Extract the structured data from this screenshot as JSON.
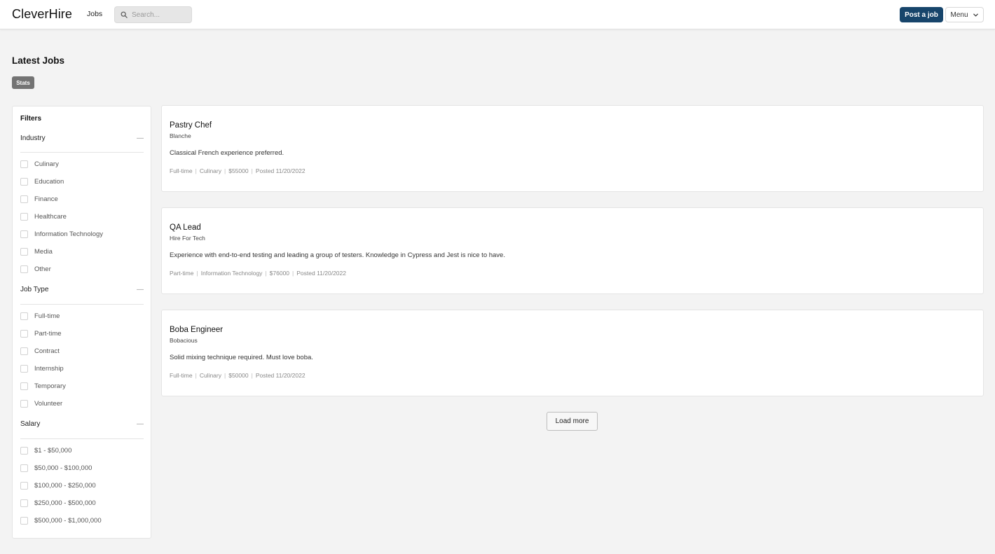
{
  "header": {
    "brand": "CleverHire",
    "nav_jobs": "Jobs",
    "search_placeholder": "Search...",
    "post_job_label": "Post a job",
    "menu_label": "Menu",
    "accent_color": "#17456b"
  },
  "page": {
    "title": "Latest Jobs",
    "stats_label": "Stats"
  },
  "filters": {
    "title": "Filters",
    "sections": [
      {
        "label": "Industry",
        "collapse_symbol": "—",
        "options": [
          "Culinary",
          "Education",
          "Finance",
          "Healthcare",
          "Information Technology",
          "Media",
          "Other"
        ]
      },
      {
        "label": "Job Type",
        "collapse_symbol": "—",
        "options": [
          "Full-time",
          "Part-time",
          "Contract",
          "Internship",
          "Temporary",
          "Volunteer"
        ]
      },
      {
        "label": "Salary",
        "collapse_symbol": "—",
        "options": [
          "$1 - $50,000",
          "$50,000 - $100,000",
          "$100,000 - $250,000",
          "$250,000 - $500,000",
          "$500,000 - $1,000,000"
        ]
      }
    ]
  },
  "jobs": [
    {
      "title": "Pastry Chef",
      "company": "Blanche",
      "description": "Classical French experience preferred.",
      "type": "Full-time",
      "industry": "Culinary",
      "salary": "$55000",
      "posted": "Posted 11/20/2022"
    },
    {
      "title": "QA Lead",
      "company": "Hire For Tech",
      "description": "Experience with end-to-end testing and leading a group of testers. Knowledge in Cypress and Jest is nice to have.",
      "type": "Part-time",
      "industry": "Information Technology",
      "salary": "$76000",
      "posted": "Posted 11/20/2022"
    },
    {
      "title": "Boba Engineer",
      "company": "Bobacious",
      "description": "Solid mixing technique required. Must love boba.",
      "type": "Full-time",
      "industry": "Culinary",
      "salary": "$50000",
      "posted": "Posted 11/20/2022"
    }
  ],
  "load_more_label": "Load more",
  "meta_separator": "|"
}
